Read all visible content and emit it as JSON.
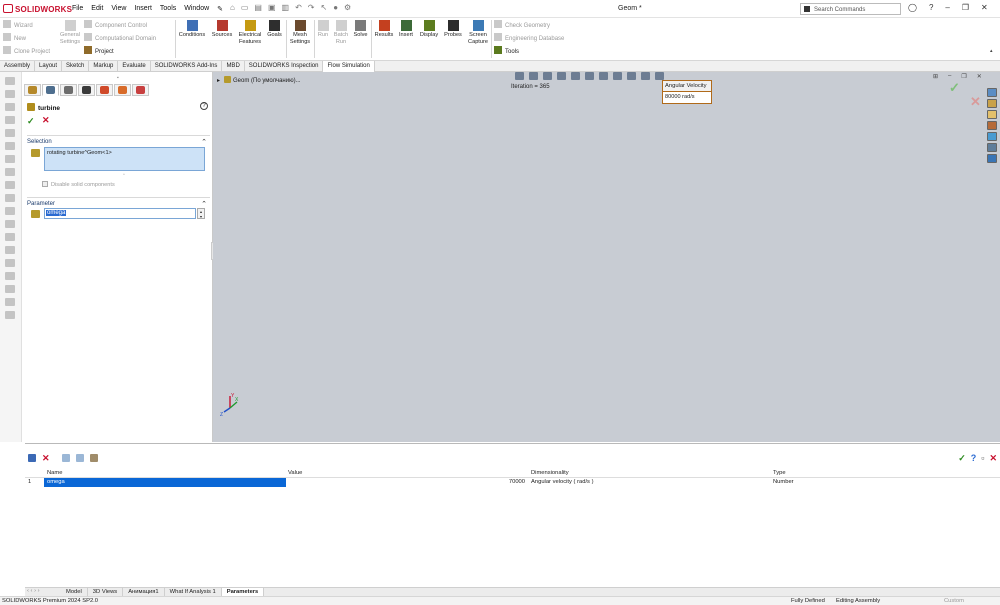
{
  "app": {
    "name": "SOLIDWORKS",
    "document_title": "Geom *"
  },
  "menu": [
    "File",
    "Edit",
    "View",
    "Insert",
    "Tools",
    "Window"
  ],
  "search": {
    "placeholder": "Search Commands"
  },
  "ribbon": {
    "left": [
      "Wizard",
      "New",
      "Clone Project"
    ],
    "general_settings": "General Settings",
    "col2": {
      "component_control": "Component Control",
      "computational_domain": "Computational Domain",
      "project": "Project"
    },
    "buttons": [
      {
        "label": "Conditions"
      },
      {
        "label": "Sources"
      },
      {
        "label": "Electrical Features"
      },
      {
        "label": "Goals"
      },
      {
        "label": "Mesh Settings"
      },
      {
        "label": "Run"
      },
      {
        "label": "Batch Run"
      },
      {
        "label": "Solve"
      },
      {
        "label": "Results"
      },
      {
        "label": "Insert"
      },
      {
        "label": "Display"
      },
      {
        "label": "Probes"
      },
      {
        "label": "Screen Capture"
      }
    ],
    "right": {
      "check_geometry": "Check Geometry",
      "engineering_database": "Engineering Database",
      "tools": "Tools"
    }
  },
  "tabs": [
    "Assembly",
    "Layout",
    "Sketch",
    "Markup",
    "Evaluate",
    "SOLIDWORKS Add-Ins",
    "MBD",
    "SOLIDWORKS Inspection",
    "Flow Simulation"
  ],
  "property_manager": {
    "title": "turbine",
    "help": "?",
    "selection": {
      "header": "Selection",
      "value": "rotating turbine^Geom<1>",
      "disable_solid": "Disable solid components"
    },
    "parameter": {
      "header": "Parameter",
      "value": "omega"
    }
  },
  "viewport": {
    "tree_label": "Geom (По умолчанию)...",
    "iteration": "Iteration = 365",
    "callout": {
      "title": "Angular Velocity",
      "value": "80000 rad/s"
    },
    "axis": {
      "x": "X",
      "y": "Y",
      "z": "Z"
    }
  },
  "parameters_table": {
    "headers": [
      "Name",
      "Value",
      "Dimensionality",
      "Type"
    ],
    "rows": [
      {
        "index": "1",
        "name": "omega",
        "value": "70000",
        "dimensionality": "Angular velocity ( rad/s )",
        "type": "Number"
      }
    ]
  },
  "doc_tabs": [
    "Model",
    "3D Views",
    "Анимация1",
    "What If Analysis 1",
    "Parameters"
  ],
  "status": {
    "product": "SOLIDWORKS Premium 2024 SP2.0",
    "defined": "Fully Defined",
    "mode": "Editing Assembly",
    "units": "Custom"
  }
}
